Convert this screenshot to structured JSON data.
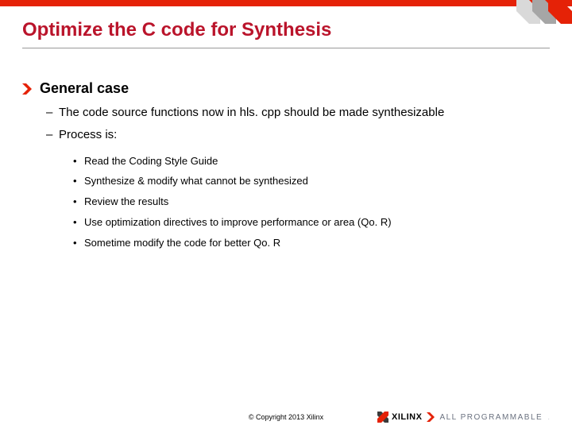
{
  "slide": {
    "title": "Optimize the C code for Synthesis",
    "heading": "General case",
    "dash_items": [
      "The code source functions now in hls. cpp should be made synthesizable",
      "Process is:"
    ],
    "dot_items": [
      "Read the Coding Style Guide",
      "Synthesize & modify what cannot be synthesized",
      "Review the results",
      "Use optimization directives to improve performance or area (Qo. R)",
      "Sometime modify the code for better Qo. R"
    ]
  },
  "footer": {
    "copyright": "© Copyright 2013 Xilinx",
    "brand_name": "XILINX",
    "slogan": "ALL PROGRAMMABLE",
    "slogan_suffix": "."
  },
  "colors": {
    "accent": "#e52207",
    "title": "#ba142b"
  }
}
